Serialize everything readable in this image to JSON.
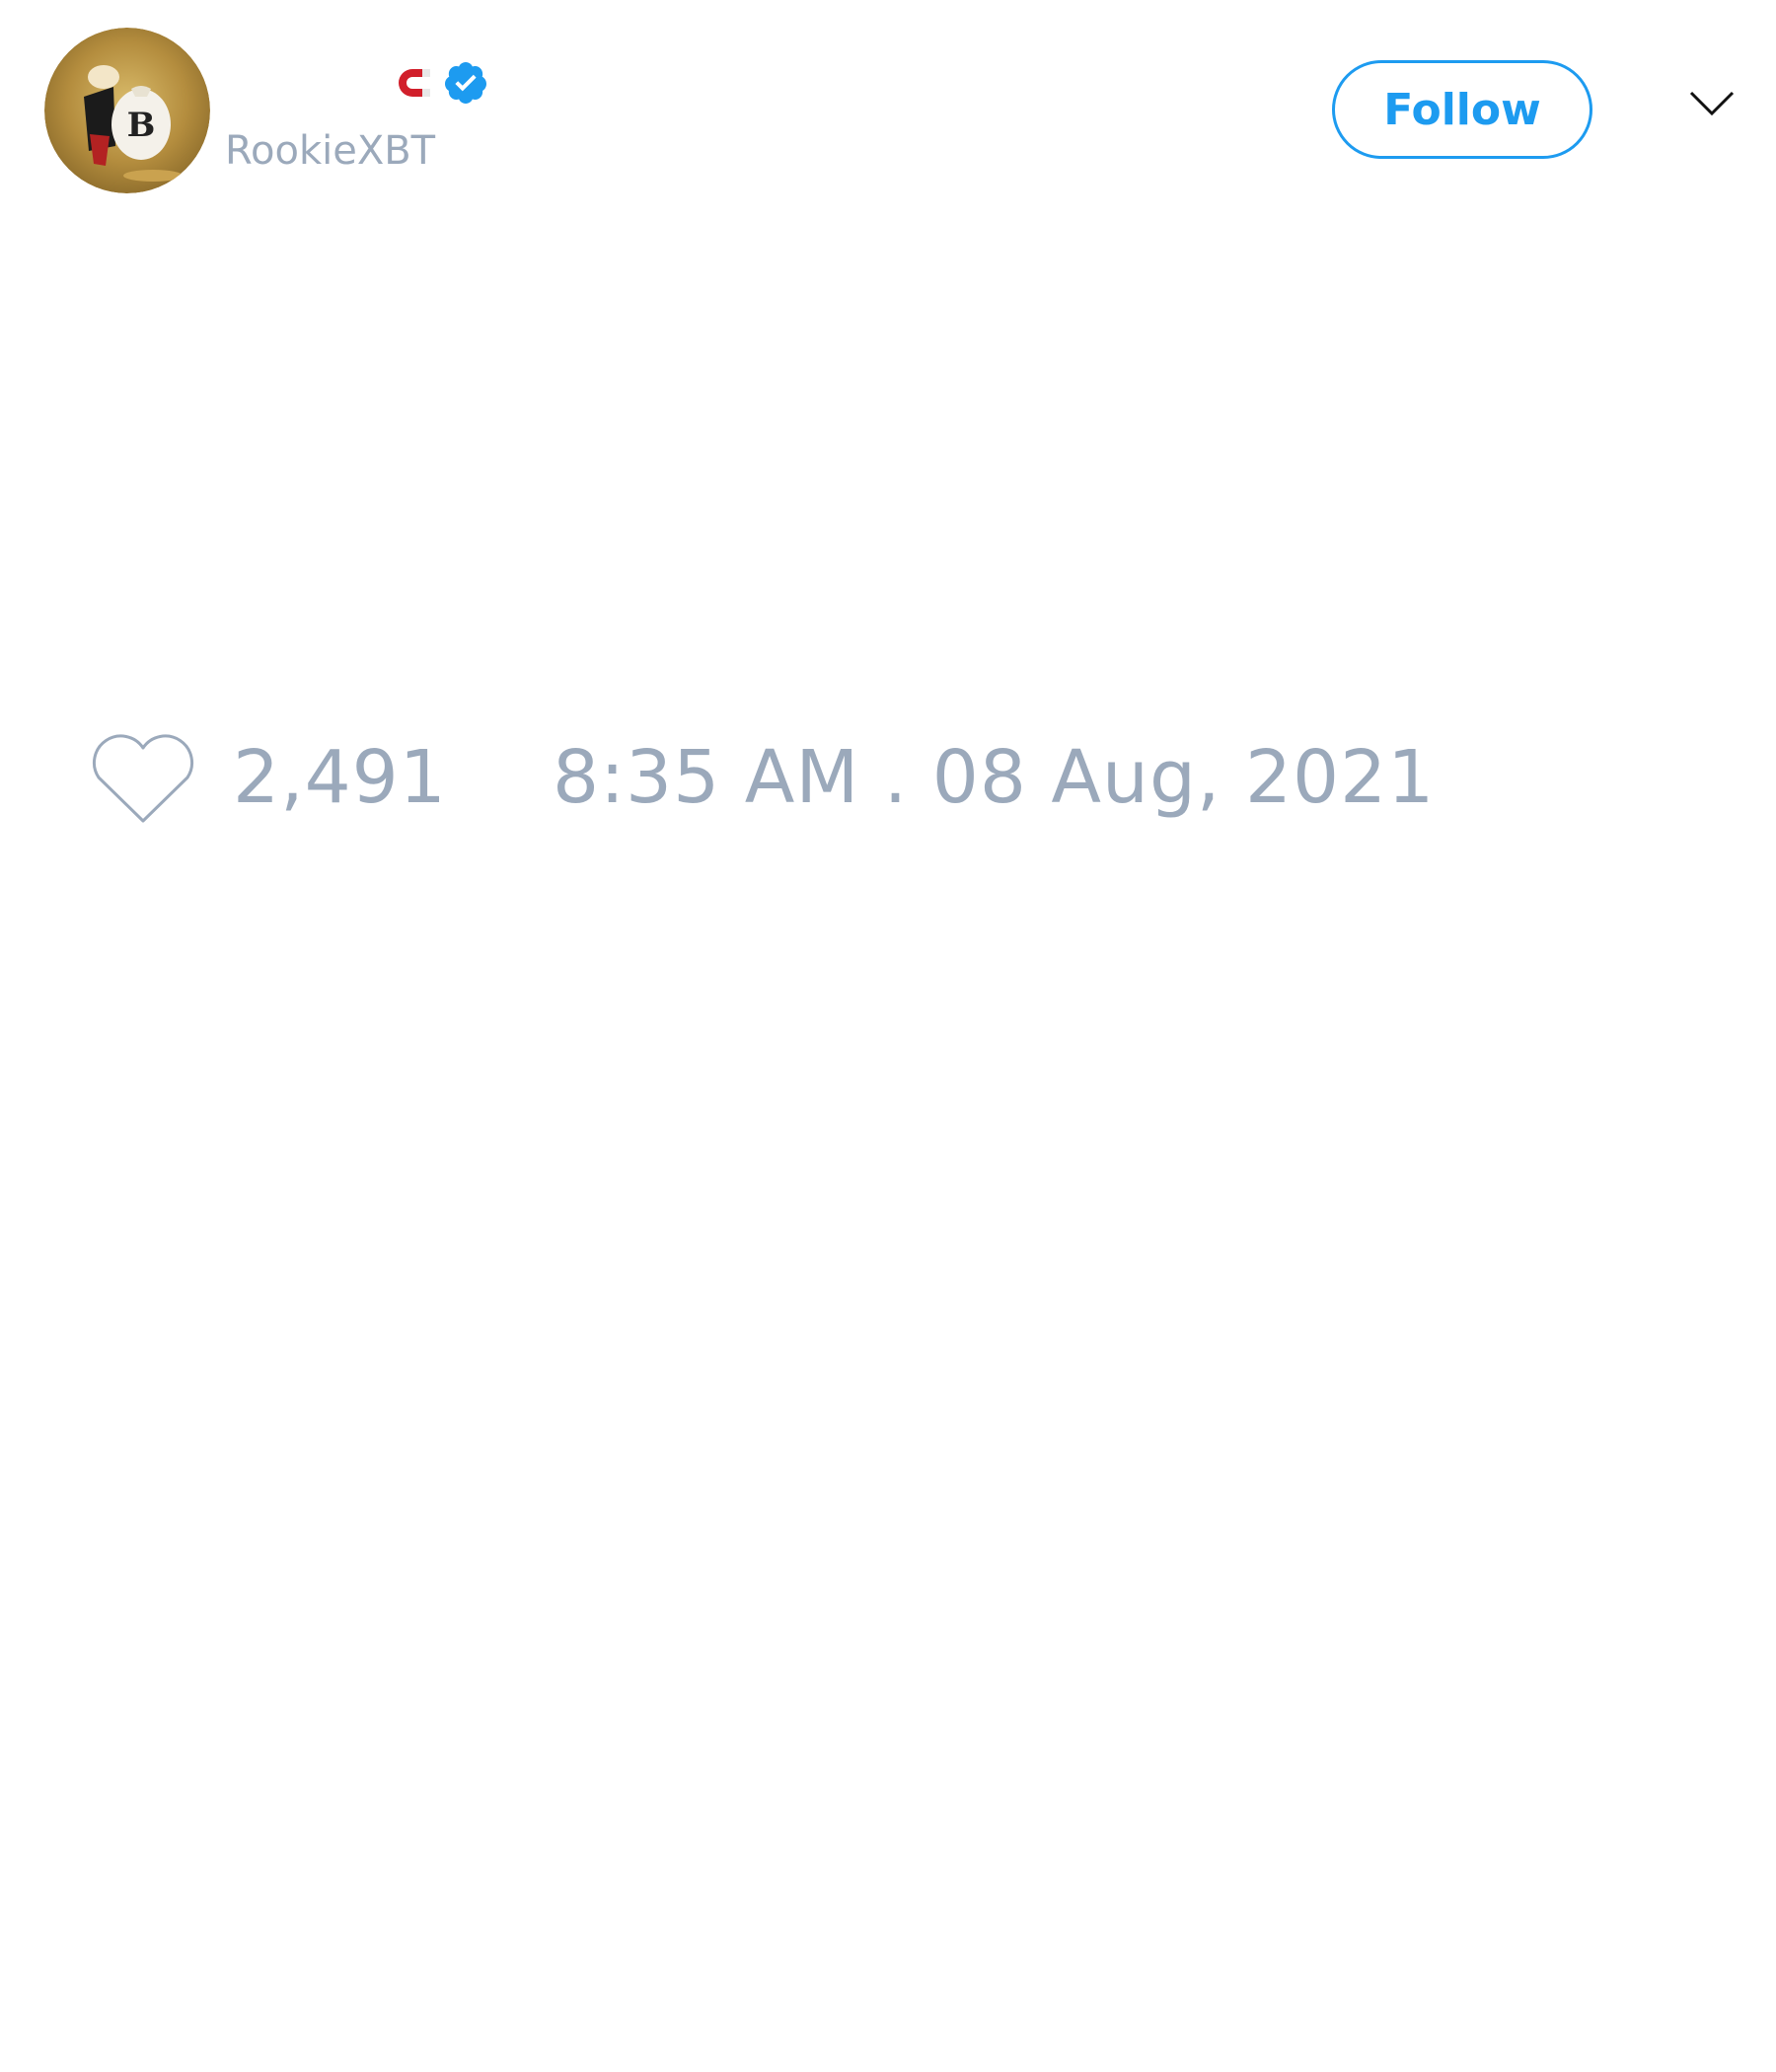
{
  "tweet": {
    "author": {
      "handle": "RookieXBT",
      "avatar_icon": "avatar-image",
      "name_icons": [
        "magnet-icon",
        "verified-badge-icon"
      ],
      "verified_color": "#1d9bf0",
      "magnet_color": "#d11f2b"
    },
    "follow_label": "Follow",
    "menu_icon": "chevron-down-icon",
    "likes": {
      "icon": "heart-icon",
      "count": "2,491"
    },
    "timestamp": "8:35 AM . 08 Aug, 2021"
  },
  "colors": {
    "accent": "#1d9bf0",
    "muted_text": "#9ba9bb",
    "background": "#ffffff"
  }
}
